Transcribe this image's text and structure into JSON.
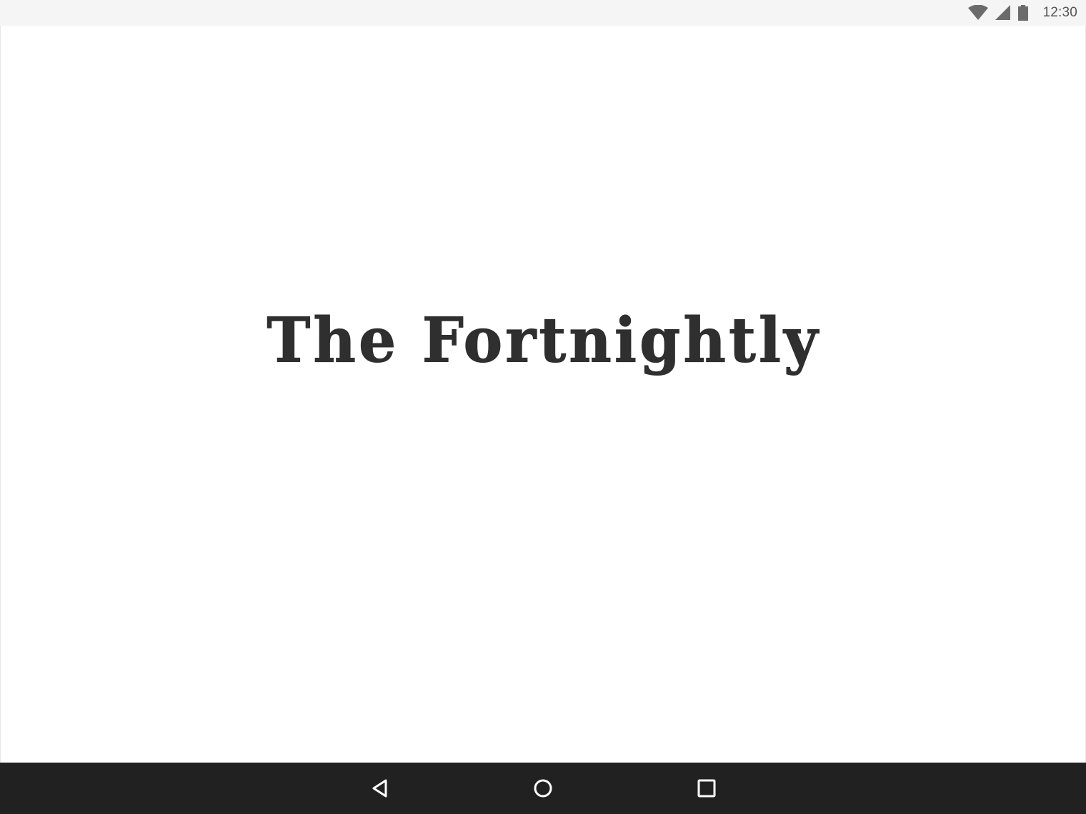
{
  "status_bar": {
    "time": "12:30",
    "icons": [
      "wifi-icon",
      "cellular-signal-icon",
      "battery-icon"
    ],
    "background": "#f5f5f5"
  },
  "app": {
    "logo_text": "The Fortnightly",
    "logo_color": "#2f2f2f",
    "background": "#ffffff"
  },
  "nav_bar": {
    "background": "#212121",
    "buttons": [
      "back-icon",
      "home-icon",
      "recents-icon"
    ]
  }
}
